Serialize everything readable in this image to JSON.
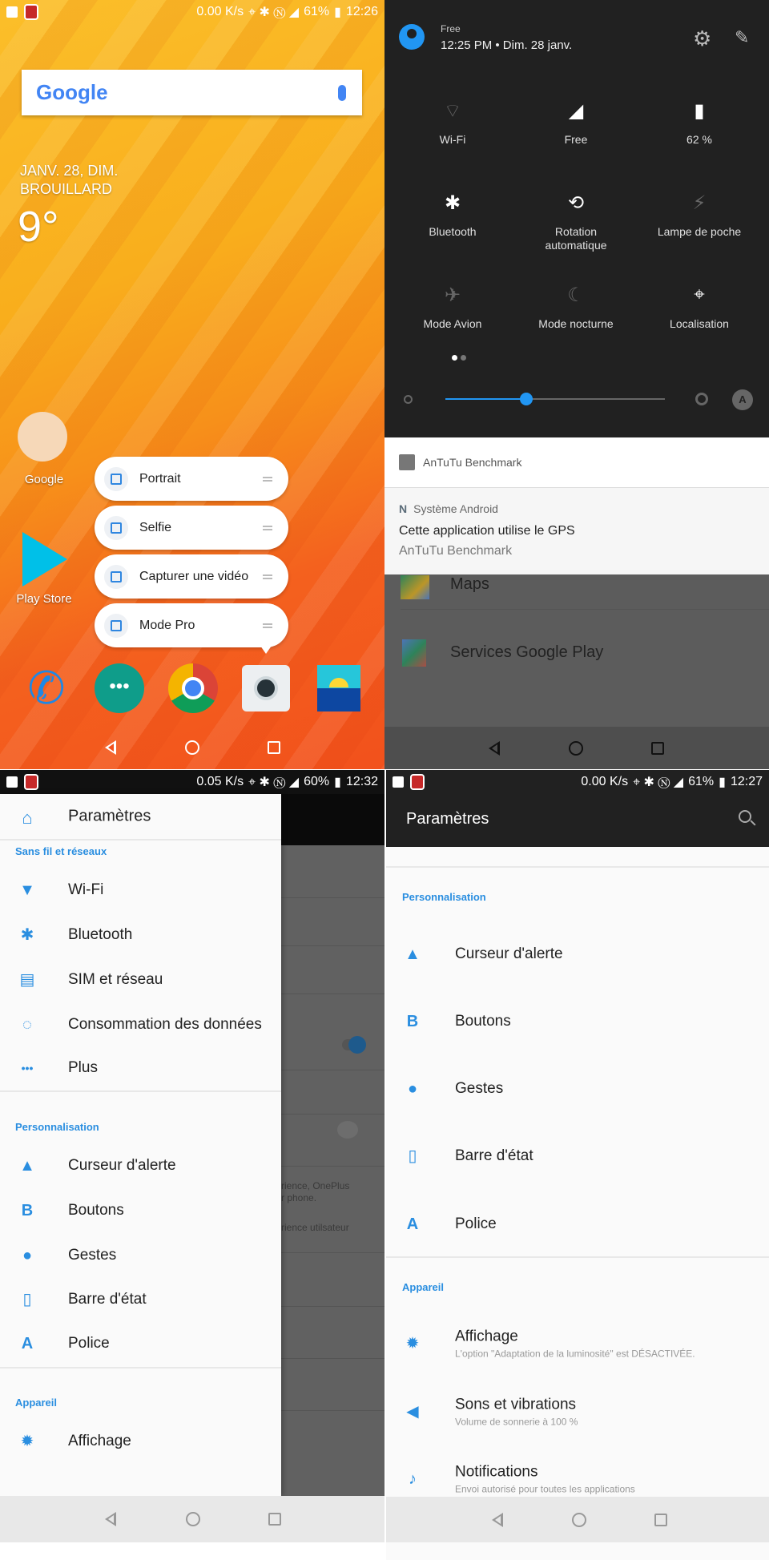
{
  "home": {
    "status": {
      "speed": "0.00 K/s",
      "battery": "61%",
      "time": "12:26"
    },
    "search_logo": "Google",
    "weather": {
      "date": "JANV. 28, DIM.",
      "condition": "BROUILLARD",
      "temp": "9°"
    },
    "apps": [
      {
        "label": "Google"
      },
      {
        "label": "Play Store"
      }
    ],
    "shortcuts": [
      {
        "label": "Portrait"
      },
      {
        "label": "Selfie"
      },
      {
        "label": "Capturer une vidéo"
      },
      {
        "label": "Mode Pro"
      }
    ],
    "dock": [
      "phone",
      "hangouts",
      "chrome",
      "camera",
      "gallery"
    ]
  },
  "quick_settings": {
    "carrier": "Free",
    "datetime": "12:25 PM • Dim. 28 janv.",
    "tiles": [
      {
        "label": "Wi-Fi",
        "icon": "wifi-off-icon",
        "active": false
      },
      {
        "label": "Free",
        "icon": "signal-3g-icon",
        "active": true
      },
      {
        "label": "62 %",
        "icon": "battery-icon",
        "active": true
      },
      {
        "label": "Bluetooth",
        "icon": "bluetooth-icon",
        "active": true
      },
      {
        "label": "Rotation automatique",
        "icon": "rotation-icon",
        "active": true
      },
      {
        "label": "Lampe de poche",
        "icon": "flashlight-icon",
        "active": false
      },
      {
        "label": "Mode Avion",
        "icon": "airplane-icon",
        "active": false
      },
      {
        "label": "Mode nocturne",
        "icon": "night-mode-icon",
        "active": false
      },
      {
        "label": "Localisation",
        "icon": "location-icon",
        "active": true
      }
    ],
    "brightness": 0.37,
    "page": 1,
    "pages": 2,
    "notifications": [
      {
        "app": "AnTuTu Benchmark"
      },
      {
        "app": "Système Android",
        "title": "Cette application utilise le GPS",
        "text": "AnTuTu Benchmark"
      }
    ],
    "behind_list": [
      "Maps",
      "Services Google Play"
    ]
  },
  "drawer": {
    "status": {
      "speed": "0.05 K/s",
      "battery": "60%",
      "time": "12:32"
    },
    "header": "Paramètres",
    "sections": [
      {
        "title": "Sans fil et réseaux",
        "items": [
          "Wi-Fi",
          "Bluetooth",
          "SIM et réseau",
          "Consommation des données",
          "Plus"
        ]
      },
      {
        "title": "Personnalisation",
        "items": [
          "Curseur d'alerte",
          "Boutons",
          "Gestes",
          "Barre d'état",
          "Police"
        ]
      },
      {
        "title": "Appareil",
        "items": [
          "Affichage"
        ]
      }
    ],
    "behind_text": [
      "rience, OnePlus",
      "r phone.",
      "rience utilsateur"
    ]
  },
  "settings": {
    "status": {
      "speed": "0.00 K/s",
      "battery": "61%",
      "time": "12:27"
    },
    "title": "Paramètres",
    "sections": [
      {
        "title": "Personnalisation",
        "items": [
          {
            "label": "Curseur d'alerte"
          },
          {
            "label": "Boutons"
          },
          {
            "label": "Gestes"
          },
          {
            "label": "Barre d'état"
          },
          {
            "label": "Police"
          }
        ]
      },
      {
        "title": "Appareil",
        "items": [
          {
            "label": "Affichage",
            "sub": "L'option \"Adaptation de la luminosité\" est DÉSACTIVÉE."
          },
          {
            "label": "Sons et vibrations",
            "sub": "Volume de sonnerie à 100 %"
          },
          {
            "label": "Notifications",
            "sub": "Envoi autorisé pour toutes les applications"
          }
        ]
      }
    ]
  },
  "colors": {
    "accent": "#2a8ee0",
    "qs_bg": "#212121",
    "wallpaper": "#f7901a"
  }
}
